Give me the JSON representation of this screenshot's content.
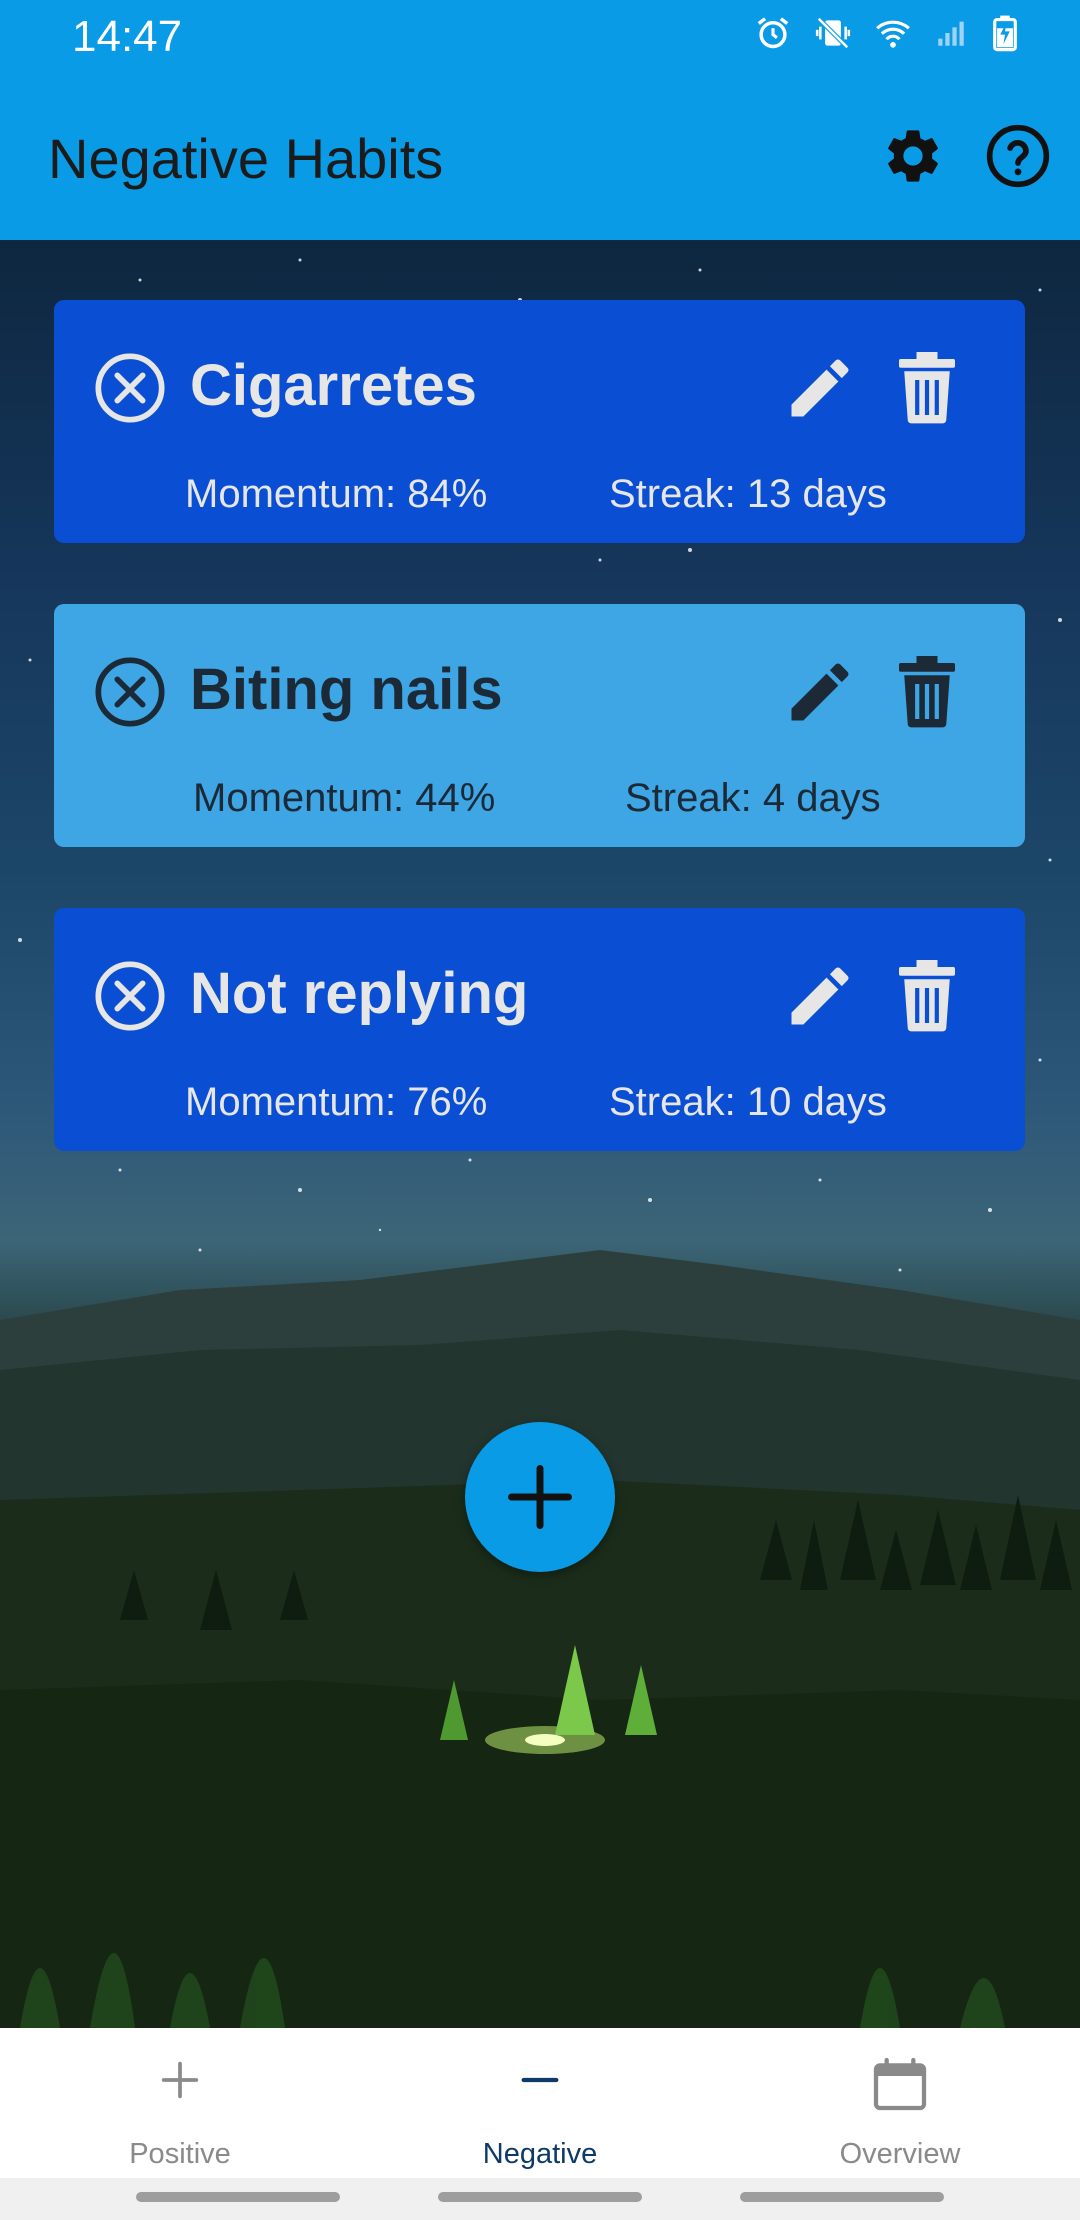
{
  "status_bar": {
    "time": "14:47",
    "icons": [
      "alarm-icon",
      "vibrate-mute-icon",
      "wifi-icon",
      "signal-icon",
      "battery-charging-icon"
    ]
  },
  "app_bar": {
    "title": "Negative Habits",
    "actions": [
      "gear-icon",
      "help-circle-icon"
    ]
  },
  "habits": [
    {
      "name": "Cigarretes",
      "momentum": "Momentum: 84%",
      "streak": "Streak: 13 days",
      "style": "dark"
    },
    {
      "name": "Biting nails",
      "momentum": "Momentum: 44%",
      "streak": "Streak: 4 days",
      "style": "light"
    },
    {
      "name": "Not replying",
      "momentum": "Momentum: 76%",
      "streak": "Streak: 10 days",
      "style": "dark"
    }
  ],
  "fab": {
    "icon": "plus-icon"
  },
  "bottom_nav": {
    "items": [
      {
        "label": "Positive",
        "icon": "plus-icon",
        "active": false
      },
      {
        "label": "Negative",
        "icon": "minus-icon",
        "active": true
      },
      {
        "label": "Overview",
        "icon": "calendar-icon",
        "active": false
      }
    ]
  },
  "colors": {
    "primary": "#0a9be6",
    "card_dark": "#0a4fd3",
    "card_light": "#3ea6e4",
    "nav_active": "#0d3a66"
  }
}
